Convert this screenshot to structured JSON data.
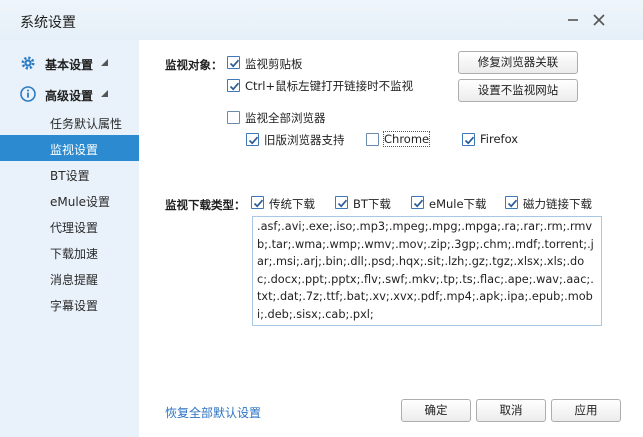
{
  "window": {
    "title": "系统设置"
  },
  "sidebar": {
    "groups": [
      {
        "label": "基本设置",
        "icon": "gear-icon"
      },
      {
        "label": "高级设置",
        "icon": "info-icon"
      }
    ],
    "items": [
      {
        "label": "任务默认属性"
      },
      {
        "label": "监视设置",
        "active": true
      },
      {
        "label": "BT设置"
      },
      {
        "label": "eMule设置"
      },
      {
        "label": "代理设置"
      },
      {
        "label": "下载加速"
      },
      {
        "label": "消息提醒"
      },
      {
        "label": "字幕设置"
      }
    ]
  },
  "monitor": {
    "object_label": "监视对象：",
    "clipboard": {
      "label": "监视剪贴板",
      "checked": true
    },
    "ctrl_click": {
      "label": "Ctrl+鼠标左键打开链接时不监视",
      "checked": true
    },
    "all_browsers": {
      "label": "监视全部浏览器",
      "checked": false
    },
    "old_browser": {
      "label": "旧版浏览器支持",
      "checked": true
    },
    "chrome": {
      "label": "Chrome",
      "checked": false
    },
    "firefox": {
      "label": "Firefox",
      "checked": true
    },
    "repair_button": "修复浏览器关联",
    "exclude_button": "设置不监视网站"
  },
  "download_types": {
    "label": "监视下载类型：",
    "normal": {
      "label": "传统下载",
      "checked": true
    },
    "bt": {
      "label": "BT下载",
      "checked": true
    },
    "emule": {
      "label": "eMule下载",
      "checked": true
    },
    "magnet": {
      "label": "磁力链接下载",
      "checked": true
    },
    "extensions": ".asf;.avi;.exe;.iso;.mp3;.mpeg;.mpg;.mpga;.ra;.rar;.rm;.rmvb;.tar;.wma;.wmp;.wmv;.mov;.zip;.3gp;.chm;.mdf;.torrent;.jar;.msi;.arj;.bin;.dll;.psd;.hqx;.sit;.lzh;.gz;.tgz;.xlsx;.xls;.doc;.docx;.ppt;.pptx;.flv;.swf;.mkv;.tp;.ts;.flac;.ape;.wav;.aac;.txt;.dat;.7z;.ttf;.bat;.xv;.xvx;.pdf;.mp4;.apk;.ipa;.epub;.mobi;.deb;.sisx;.cab;.pxl;"
  },
  "footer": {
    "restore_link": "恢复全部默认设置",
    "ok": "确定",
    "cancel": "取消",
    "apply": "应用"
  },
  "colors": {
    "accent": "#2b8ad0",
    "sidebar_bg": "#e9f2fa",
    "link": "#2b73c4"
  }
}
